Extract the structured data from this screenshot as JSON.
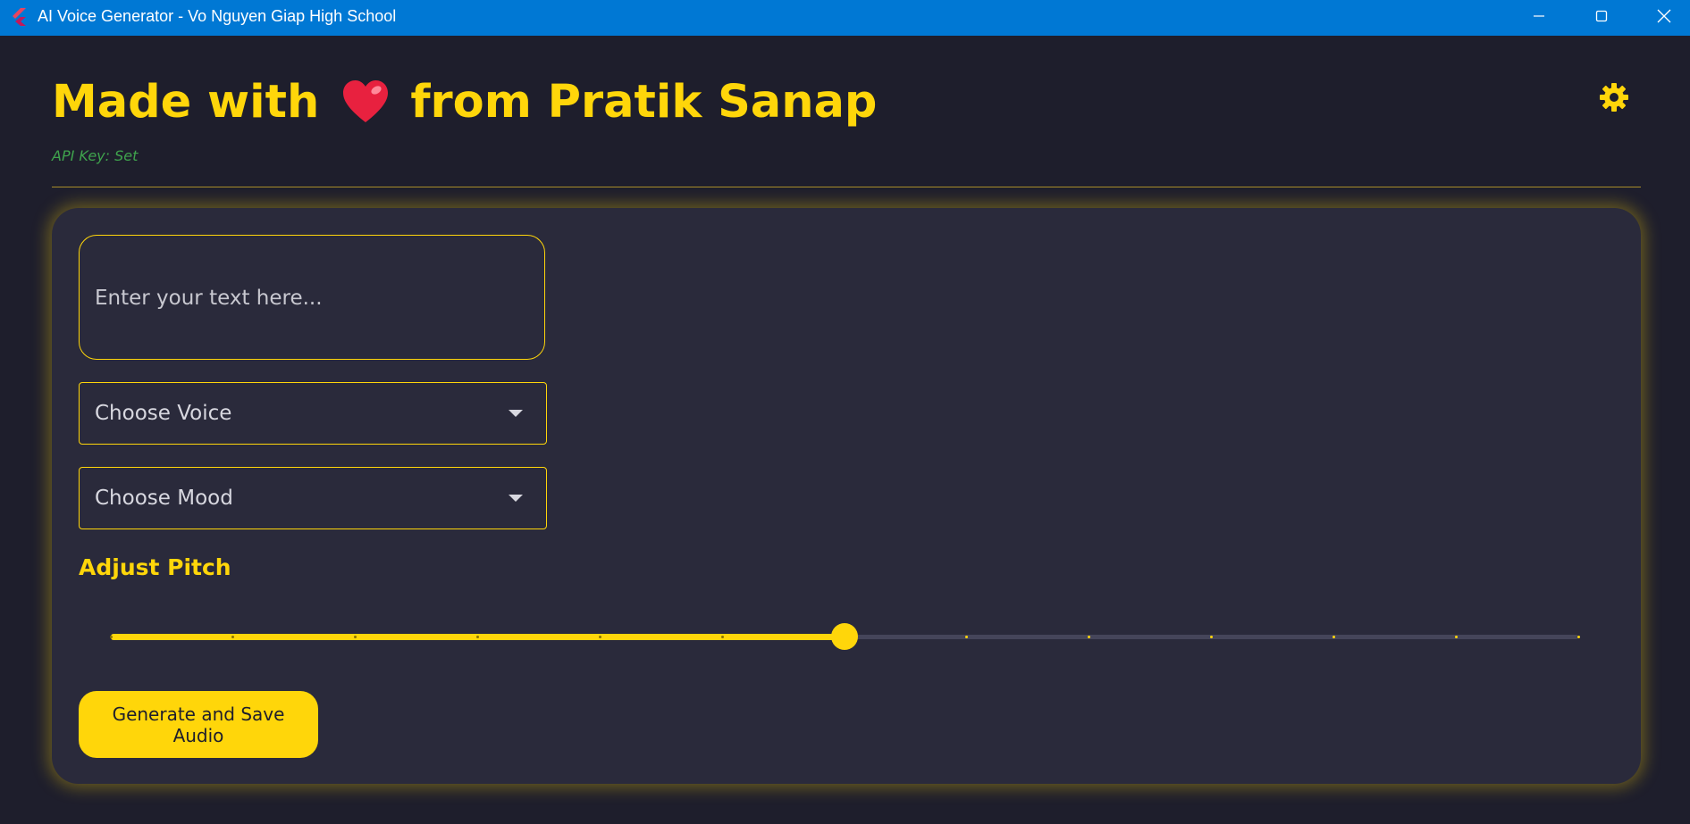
{
  "window": {
    "title": "AI Voice Generator - Vo Nguyen Giap High School",
    "app_icon": "flutter-icon",
    "controls": [
      "minimize-icon",
      "maximize-icon",
      "close-icon"
    ]
  },
  "header": {
    "title_prefix": "Made with",
    "title_icon": "heart-emoji",
    "title_suffix": "from Pratik Sanap",
    "settings_icon": "gear-icon",
    "api_status": "API Key: Set"
  },
  "form": {
    "text_input": {
      "value": "",
      "placeholder": "Enter your text here..."
    },
    "voice_select": {
      "label": "Choose Voice",
      "icon": "dropdown-arrow-icon"
    },
    "mood_select": {
      "label": "Choose Mood",
      "icon": "dropdown-arrow-icon"
    },
    "pitch": {
      "label": "Adjust Pitch",
      "value_fraction": 0.5,
      "divisions": 12
    },
    "generate_button": "Generate and Save Audio"
  },
  "colors": {
    "titlebar": "#0078d4",
    "background": "#1e1e2c",
    "card": "#2a2a3b",
    "accent": "#ffd60a",
    "api_status": "#3fa34d",
    "slider_inactive": "#45455a"
  }
}
